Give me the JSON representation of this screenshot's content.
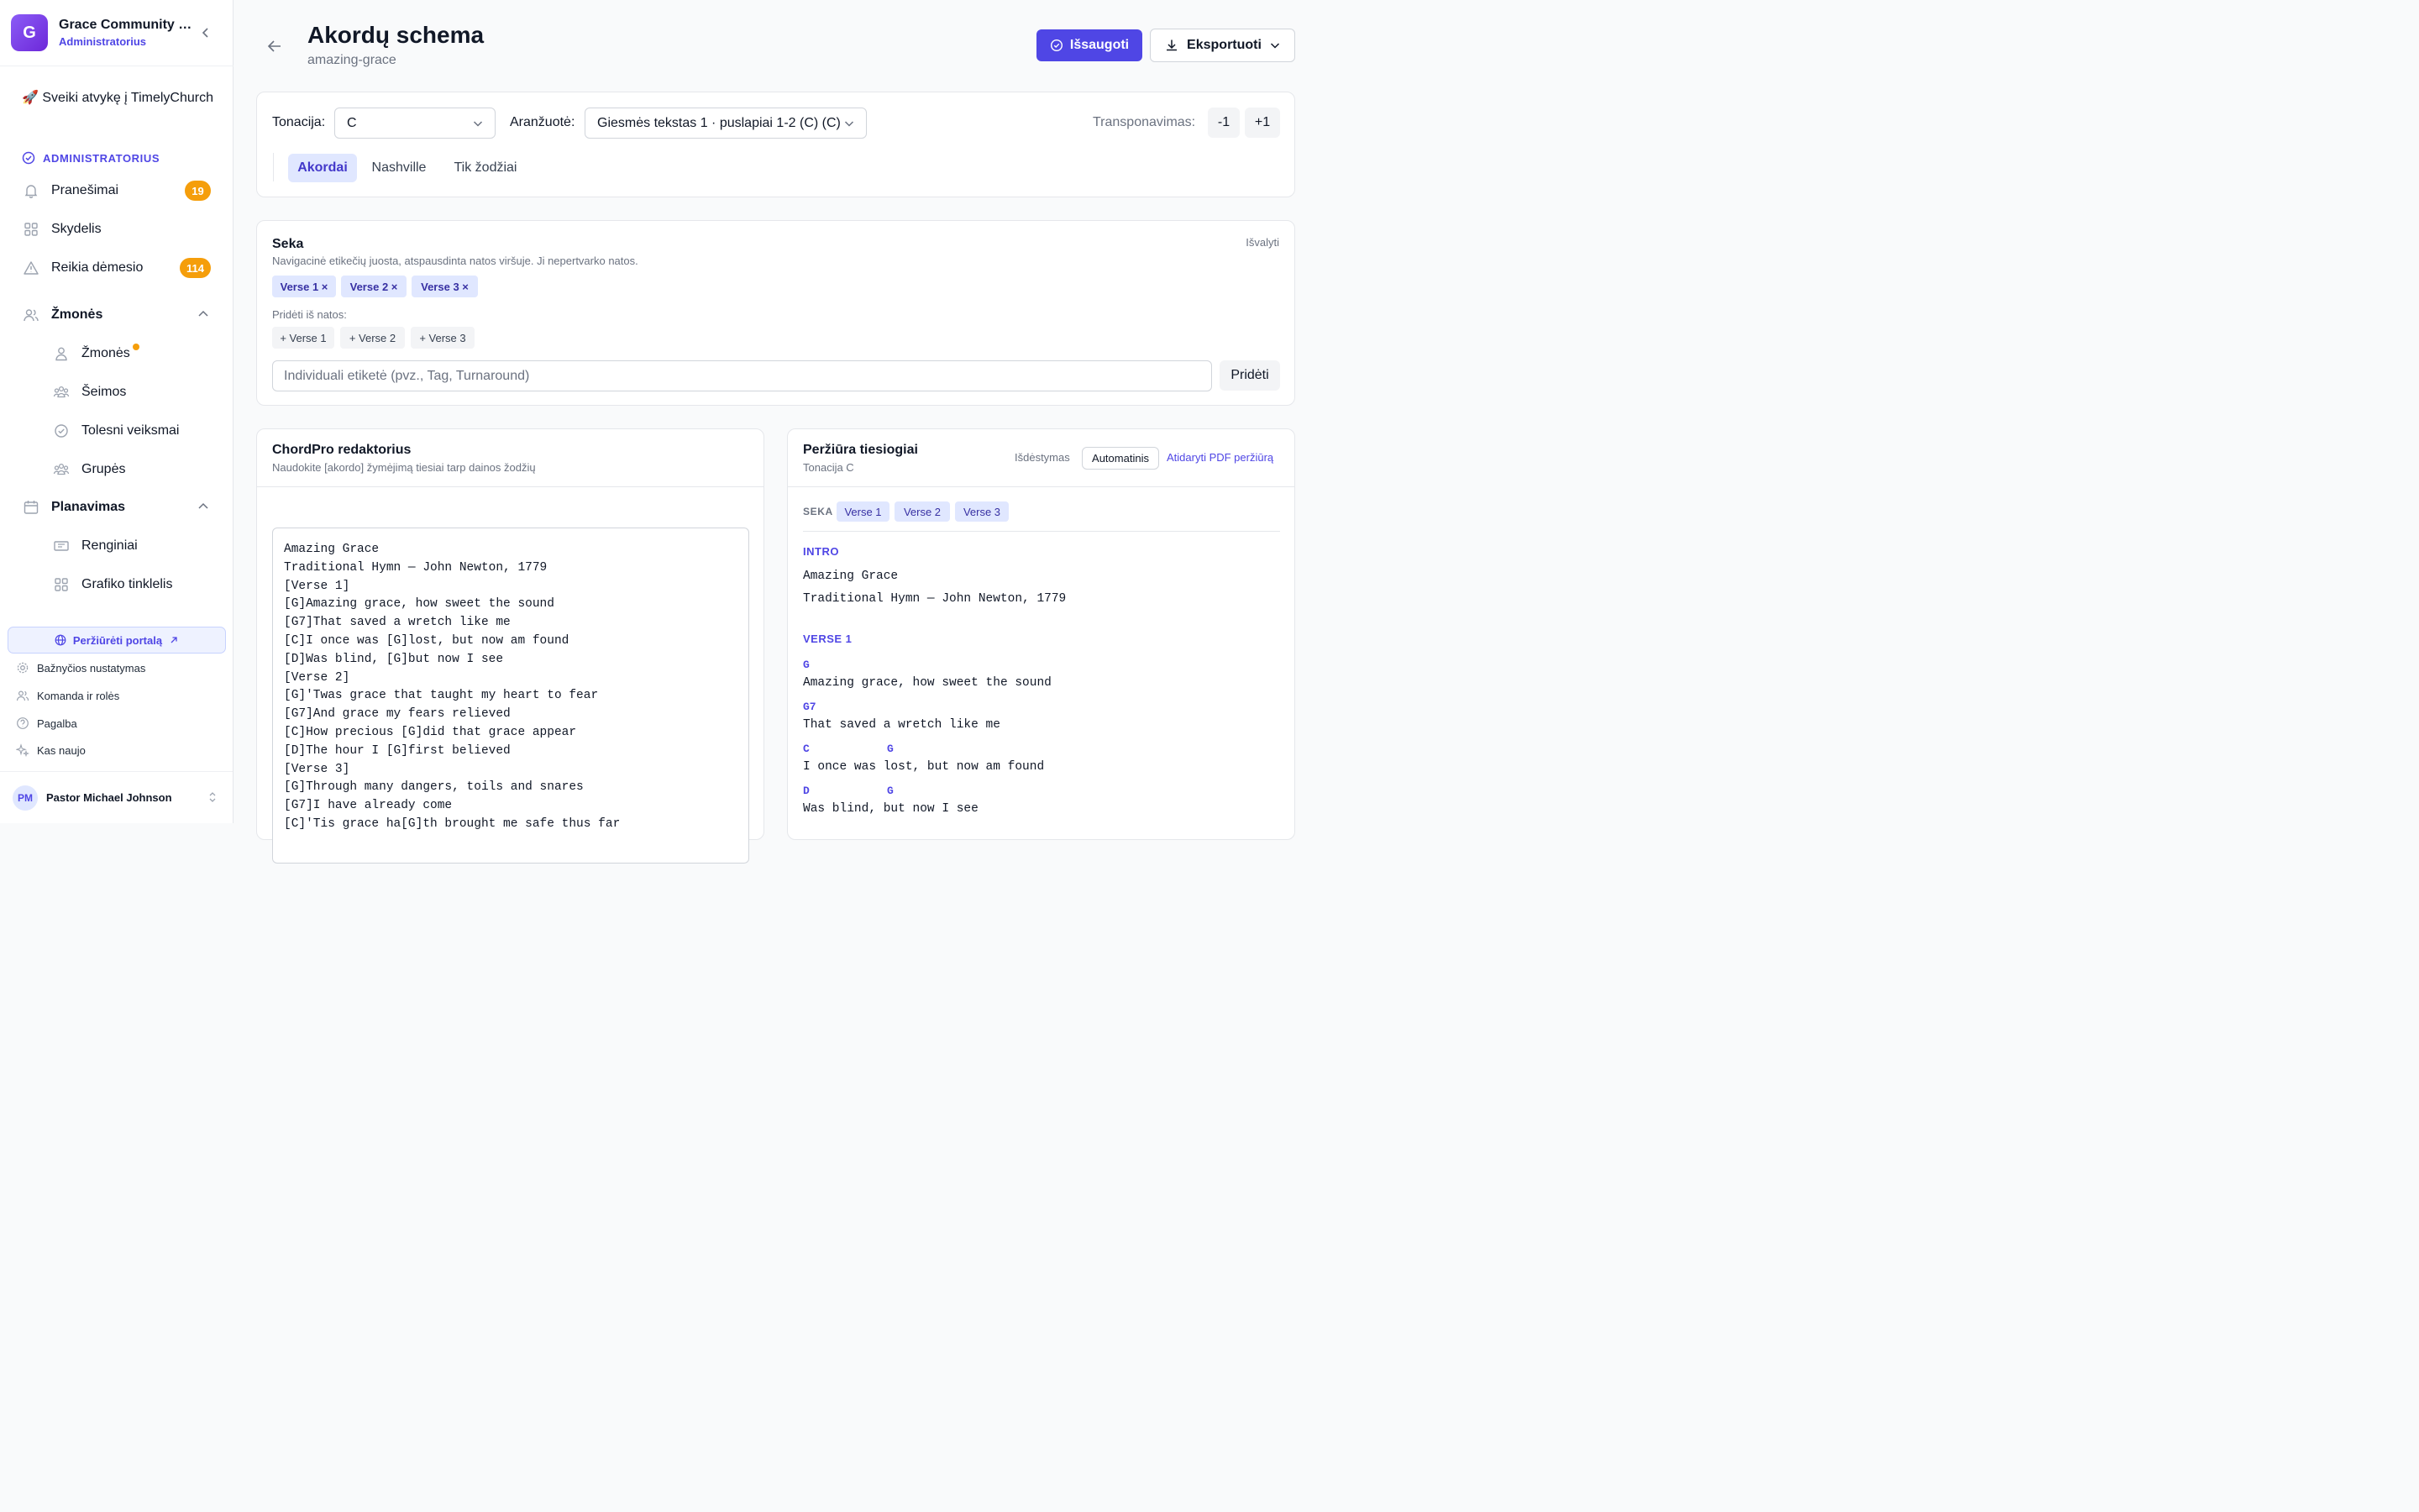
{
  "sidebar": {
    "org_name": "Grace Community Church",
    "org_role": "Administratorius",
    "welcome": "🚀 Sveiki atvykę į TimelyChurch",
    "section": "ADMINISTRATORIUS",
    "items": {
      "notifications": {
        "label": "Pranešimai",
        "badge": "19"
      },
      "dashboard": {
        "label": "Skydelis"
      },
      "attention": {
        "label": "Reikia dėmesio",
        "badge": "114"
      },
      "people_group": {
        "label": "Žmonės"
      },
      "people": {
        "label": "Žmonės"
      },
      "families": {
        "label": "Šeimos"
      },
      "followups": {
        "label": "Tolesni veiksmai"
      },
      "groups": {
        "label": "Grupės"
      },
      "planning_group": {
        "label": "Planavimas"
      },
      "events": {
        "label": "Renginiai"
      },
      "schedule_grid": {
        "label": "Grafiko tinklelis"
      }
    },
    "portal_button": "Peržiūrėti portalą",
    "footer": {
      "church_settings": "Bažnyčios nustatymas",
      "team_roles": "Komanda ir rolės",
      "help": "Pagalba",
      "whats_new": "Kas naujo"
    },
    "user": {
      "initials": "PM",
      "name": "Pastor Michael Johnson"
    }
  },
  "header": {
    "title": "Akordų schema",
    "subtitle": "amazing-grace",
    "save_label": "Išsaugoti",
    "export_label": "Eksportuoti"
  },
  "controls": {
    "key_label": "Tonacija:",
    "key_value": "C",
    "arrangement_label": "Aranžuotė:",
    "arrangement_value": "Giesmės tekstas 1 · puslapiai 1-2 (C) (C)",
    "transpose_label": "Transponavimas:",
    "transpose_down": "-1",
    "transpose_up": "+1",
    "tabs": [
      "Akordai",
      "Nashville",
      "Tik žodžiai"
    ]
  },
  "sequence": {
    "title": "Seka",
    "description": "Navigacinė etikečių juosta, atspausdinta natos viršuje. Ji nepertvarko natos.",
    "clear": "Išvalyti",
    "chips": [
      "Verse 1 ×",
      "Verse 2 ×",
      "Verse 3 ×"
    ],
    "add_from_label": "Pridėti iš natos:",
    "add_chips": [
      "+ Verse 1",
      "+ Verse 2",
      "+ Verse 3"
    ],
    "custom_placeholder": "Individuali etiketė (pvz., Tag, Turnaround)",
    "add_button": "Pridėti"
  },
  "editor": {
    "title": "ChordPro redaktorius",
    "description": "Naudokite [akordo] žymėjimą tiesiai tarp dainos žodžių",
    "content": "Amazing Grace\nTraditional Hymn — John Newton, 1779\n[Verse 1]\n[G]Amazing grace, how sweet the sound\n[G7]That saved a wretch like me\n[C]I once was [G]lost, but now am found\n[D]Was blind, [G]but now I see\n[Verse 2]\n[G]'Twas grace that taught my heart to fear\n[G7]And grace my fears relieved\n[C]How precious [G]did that grace appear\n[D]The hour I [G]first believed\n[Verse 3]\n[G]Through many dangers, toils and snares\n[G7]I have already come\n[C]'Tis grace ha[G]th brought me safe thus far"
  },
  "preview": {
    "title": "Peržiūra tiesiogiai",
    "subtitle": "Tonacija C",
    "layout_label": "Išdėstymas",
    "layout_value": "Automatinis",
    "pdf_link": "Atidaryti PDF peržiūrą",
    "seq_label": "SEKA",
    "seq_chips": [
      "Verse 1",
      "Verse 2",
      "Verse 3"
    ],
    "intro_label": "INTRO",
    "intro_lines": [
      "Amazing Grace",
      "Traditional Hymn — John Newton, 1779"
    ],
    "verse1_label": "VERSE 1",
    "lines": [
      {
        "chords": [
          "G"
        ],
        "lyric": "Amazing grace, how sweet the sound"
      },
      {
        "chords": [
          "G7"
        ],
        "lyric": "That saved a wretch like me"
      },
      {
        "chords": [
          "C",
          "G"
        ],
        "lyric": "I once was lost, but now am found"
      },
      {
        "chords": [
          "D",
          "G"
        ],
        "lyric": "Was blind, but now I see"
      }
    ]
  },
  "colors": {
    "accent": "#4f46e5",
    "badge": "#f59e0b",
    "chip_bg": "#e0e7ff"
  }
}
